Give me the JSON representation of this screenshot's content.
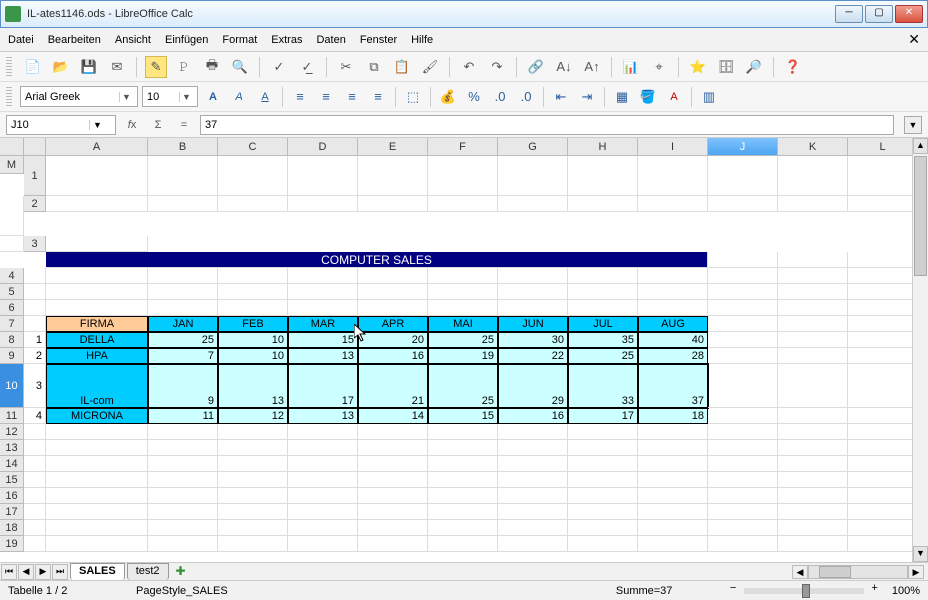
{
  "window": {
    "title": "IL-ates1146.ods - LibreOffice Calc",
    "min": "─",
    "max": "▢",
    "close": "✕"
  },
  "menu": {
    "items": [
      "Datei",
      "Bearbeiten",
      "Ansicht",
      "Einfügen",
      "Format",
      "Extras",
      "Daten",
      "Fenster",
      "Hilfe"
    ],
    "closex": "✕"
  },
  "namebox": "J10",
  "formula": "37",
  "fontname": "Arial Greek",
  "fontsize": "10",
  "cols": [
    "A",
    "B",
    "C",
    "D",
    "E",
    "F",
    "G",
    "H",
    "I",
    "J",
    "K",
    "L",
    "M"
  ],
  "selcol": "J",
  "selrow": "10",
  "rows": [
    "1",
    "2",
    "3",
    "4",
    "5",
    "6",
    "7",
    "8",
    "9",
    "10",
    "11",
    "12",
    "13",
    "14",
    "15",
    "16",
    "17",
    "18",
    "19"
  ],
  "title_band": "COMPUTER SALES",
  "firma": "FIRMA",
  "months": [
    "JAN",
    "FEB",
    "MAR",
    "APR",
    "MAI",
    "JUN",
    "JUL",
    "AUG"
  ],
  "sidenum": [
    "1",
    "2",
    "3",
    "4"
  ],
  "companies": [
    "DELLA",
    "HPA",
    "IL-com",
    "MICRONA"
  ],
  "chart_data": {
    "type": "table",
    "title": "COMPUTER SALES",
    "columns": [
      "FIRMA",
      "JAN",
      "FEB",
      "MAR",
      "APR",
      "MAI",
      "JUN",
      "JUL",
      "AUG"
    ],
    "rows": [
      {
        "FIRMA": "DELLA",
        "JAN": 25,
        "FEB": 10,
        "MAR": 15,
        "APR": 20,
        "MAI": 25,
        "JUN": 30,
        "JUL": 35,
        "AUG": 40
      },
      {
        "FIRMA": "HPA",
        "JAN": 7,
        "FEB": 10,
        "MAR": 13,
        "APR": 16,
        "MAI": 19,
        "JUN": 22,
        "JUL": 25,
        "AUG": 28
      },
      {
        "FIRMA": "IL-com",
        "JAN": 9,
        "FEB": 13,
        "MAR": 17,
        "APR": 21,
        "MAI": 25,
        "JUN": 29,
        "JUL": 33,
        "AUG": 37
      },
      {
        "FIRMA": "MICRONA",
        "JAN": 11,
        "FEB": 12,
        "MAR": 13,
        "APR": 14,
        "MAI": 15,
        "JUN": 16,
        "JUL": 17,
        "AUG": 18
      }
    ]
  },
  "tabs": {
    "active": "SALES",
    "others": [
      "test2"
    ]
  },
  "status": {
    "sheet": "Tabelle 1 / 2",
    "style": "PageStyle_SALES",
    "sum": "Summe=37",
    "zoom": "100%"
  }
}
